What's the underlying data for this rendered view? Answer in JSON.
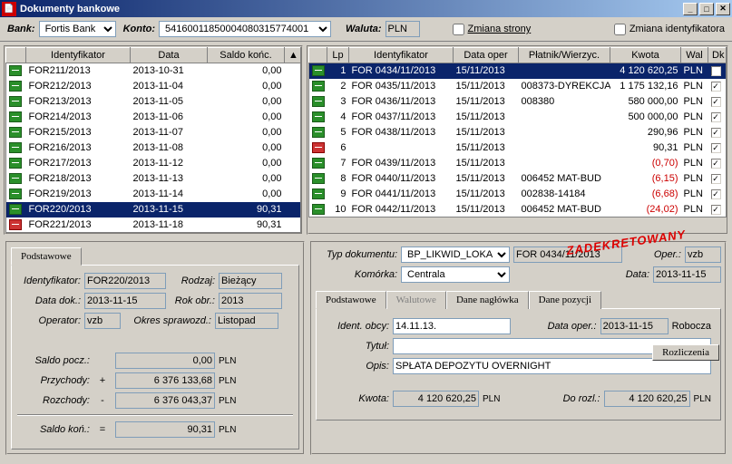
{
  "window": {
    "title": "Dokumenty bankowe"
  },
  "toolbar": {
    "bank_label": "Bank:",
    "bank_value": "Fortis Bank",
    "account_label": "Konto:",
    "account_value": "54160011850004080315774001",
    "currency_label": "Waluta:",
    "currency_value": "PLN",
    "page_change_label": "Zmiana strony",
    "ident_change_label": "Zmiana identyfikatora"
  },
  "left_grid": {
    "cols": [
      "Identyfikator",
      "Data",
      "Saldo końc."
    ],
    "rows": [
      {
        "ident": "FOR211/2013",
        "date": "2013-10-31",
        "bal": "0,00",
        "sel": false
      },
      {
        "ident": "FOR212/2013",
        "date": "2013-11-04",
        "bal": "0,00",
        "sel": false
      },
      {
        "ident": "FOR213/2013",
        "date": "2013-11-05",
        "bal": "0,00",
        "sel": false
      },
      {
        "ident": "FOR214/2013",
        "date": "2013-11-06",
        "bal": "0,00",
        "sel": false
      },
      {
        "ident": "FOR215/2013",
        "date": "2013-11-07",
        "bal": "0,00",
        "sel": false
      },
      {
        "ident": "FOR216/2013",
        "date": "2013-11-08",
        "bal": "0,00",
        "sel": false
      },
      {
        "ident": "FOR217/2013",
        "date": "2013-11-12",
        "bal": "0,00",
        "sel": false
      },
      {
        "ident": "FOR218/2013",
        "date": "2013-11-13",
        "bal": "0,00",
        "sel": false
      },
      {
        "ident": "FOR219/2013",
        "date": "2013-11-14",
        "bal": "0,00",
        "sel": false
      },
      {
        "ident": "FOR220/2013",
        "date": "2013-11-15",
        "bal": "90,31",
        "sel": true
      },
      {
        "ident": "FOR221/2013",
        "date": "2013-11-18",
        "bal": "90,31",
        "sel": false,
        "red": true
      }
    ]
  },
  "right_grid": {
    "cols": [
      "Lp",
      "Identyfikator",
      "Data oper",
      "Płatnik/Wierzyc.",
      "Kwota",
      "Wal",
      "Dk"
    ],
    "rows": [
      {
        "lp": "1",
        "ident": "FOR 0434/11/2013",
        "date": "15/11/2013",
        "party": "",
        "amt": "4 120 620,25",
        "cur": "PLN",
        "dk": true,
        "sel": true
      },
      {
        "lp": "2",
        "ident": "FOR 0435/11/2013",
        "date": "15/11/2013",
        "party": "008373-DYREKCJA",
        "amt": "1 175 132,16",
        "cur": "PLN",
        "dk": true
      },
      {
        "lp": "3",
        "ident": "FOR 0436/11/2013",
        "date": "15/11/2013",
        "party": "008380",
        "amt": "580 000,00",
        "cur": "PLN",
        "dk": true
      },
      {
        "lp": "4",
        "ident": "FOR 0437/11/2013",
        "date": "15/11/2013",
        "party": "",
        "amt": "500 000,00",
        "cur": "PLN",
        "dk": true
      },
      {
        "lp": "5",
        "ident": "FOR 0438/11/2013",
        "date": "15/11/2013",
        "party": "",
        "amt": "290,96",
        "cur": "PLN",
        "dk": true
      },
      {
        "lp": "6",
        "ident": "",
        "date": "15/11/2013",
        "party": "",
        "amt": "90,31",
        "cur": "PLN",
        "dk": true,
        "red": true
      },
      {
        "lp": "7",
        "ident": "FOR 0439/11/2013",
        "date": "15/11/2013",
        "party": "",
        "amt": "(0,70)",
        "cur": "PLN",
        "dk": true,
        "neg": true
      },
      {
        "lp": "8",
        "ident": "FOR 0440/11/2013",
        "date": "15/11/2013",
        "party": "006452 MAT-BUD",
        "amt": "(6,15)",
        "cur": "PLN",
        "dk": true,
        "neg": true
      },
      {
        "lp": "9",
        "ident": "FOR 0441/11/2013",
        "date": "15/11/2013",
        "party": "002838-14184",
        "amt": "(6,68)",
        "cur": "PLN",
        "dk": true,
        "neg": true
      },
      {
        "lp": "10",
        "ident": "FOR 0442/11/2013",
        "date": "15/11/2013",
        "party": "006452 MAT-BUD",
        "amt": "(24,02)",
        "cur": "PLN",
        "dk": true,
        "neg": true
      }
    ]
  },
  "detail_left": {
    "tab": "Podstawowe",
    "ident_label": "Identyfikator:",
    "ident_value": "FOR220/2013",
    "rodzaj_label": "Rodzaj:",
    "rodzaj_value": "Bieżący",
    "datadok_label": "Data dok.:",
    "datadok_value": "2013-11-15",
    "rokobr_label": "Rok obr.:",
    "rokobr_value": "2013",
    "operator_label": "Operator:",
    "operator_value": "vzb",
    "okres_label": "Okres sprawozd.:",
    "okres_value": "Listopad",
    "saldo_pocz_label": "Saldo pocz.:",
    "saldo_pocz": "0,00",
    "przychody_label": "Przychody:",
    "przychody": "6 376 133,68",
    "rozchody_label": "Rozchody:",
    "rozchody": "6 376 043,37",
    "saldo_kon_label": "Saldo koń.:",
    "saldo_kon": "90,31",
    "plus": "+",
    "minus": "-",
    "eq": "=",
    "pln": "PLN"
  },
  "detail_right": {
    "stamp": "ZADEKRETOWANY",
    "typ_label": "Typ dokumentu:",
    "typ_value": "BP_LIKWID_LOKA",
    "typ_value2": "FOR 0434/11/2013",
    "oper_label": "Oper.:",
    "oper_value": "vzb",
    "komorka_label": "Komórka:",
    "komorka_value": "Centrala",
    "data_label": "Data:",
    "data_value": "2013-11-15",
    "tabs": [
      "Podstawowe",
      "Walutowe",
      "Dane nagłówka",
      "Dane pozycji"
    ],
    "rozliczenia_btn": "Rozliczenia",
    "identobcy_label": "Ident. obcy:",
    "identobcy_value": "14.11.13.",
    "dataoper_label": "Data oper.:",
    "dataoper_value": "2013-11-15",
    "robocza": "Robocza",
    "tytul_label": "Tytuł:",
    "tytul_value": "",
    "opis_label": "Opis:",
    "opis_value": "SPŁATA DEPOZYTU OVERNIGHT",
    "kwota_label": "Kwota:",
    "kwota_value": "4 120 620,25",
    "dorozl_label": "Do rozl.:",
    "dorozl_value": "4 120 620,25",
    "pln": "PLN"
  }
}
